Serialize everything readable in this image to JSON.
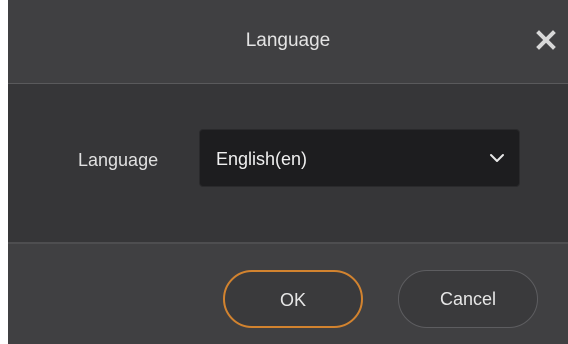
{
  "dialog": {
    "title": "Language",
    "close_icon": "close-icon"
  },
  "form": {
    "language_label": "Language",
    "language_selected": "English(en)",
    "dropdown_icon": "chevron-down-icon"
  },
  "footer": {
    "ok_label": "OK",
    "cancel_label": "Cancel"
  },
  "colors": {
    "titlebar": "#404042",
    "body": "#363638",
    "select_bg": "#1d1d1f",
    "ok_border": "#d2832f",
    "text": "#e4e4e4"
  }
}
